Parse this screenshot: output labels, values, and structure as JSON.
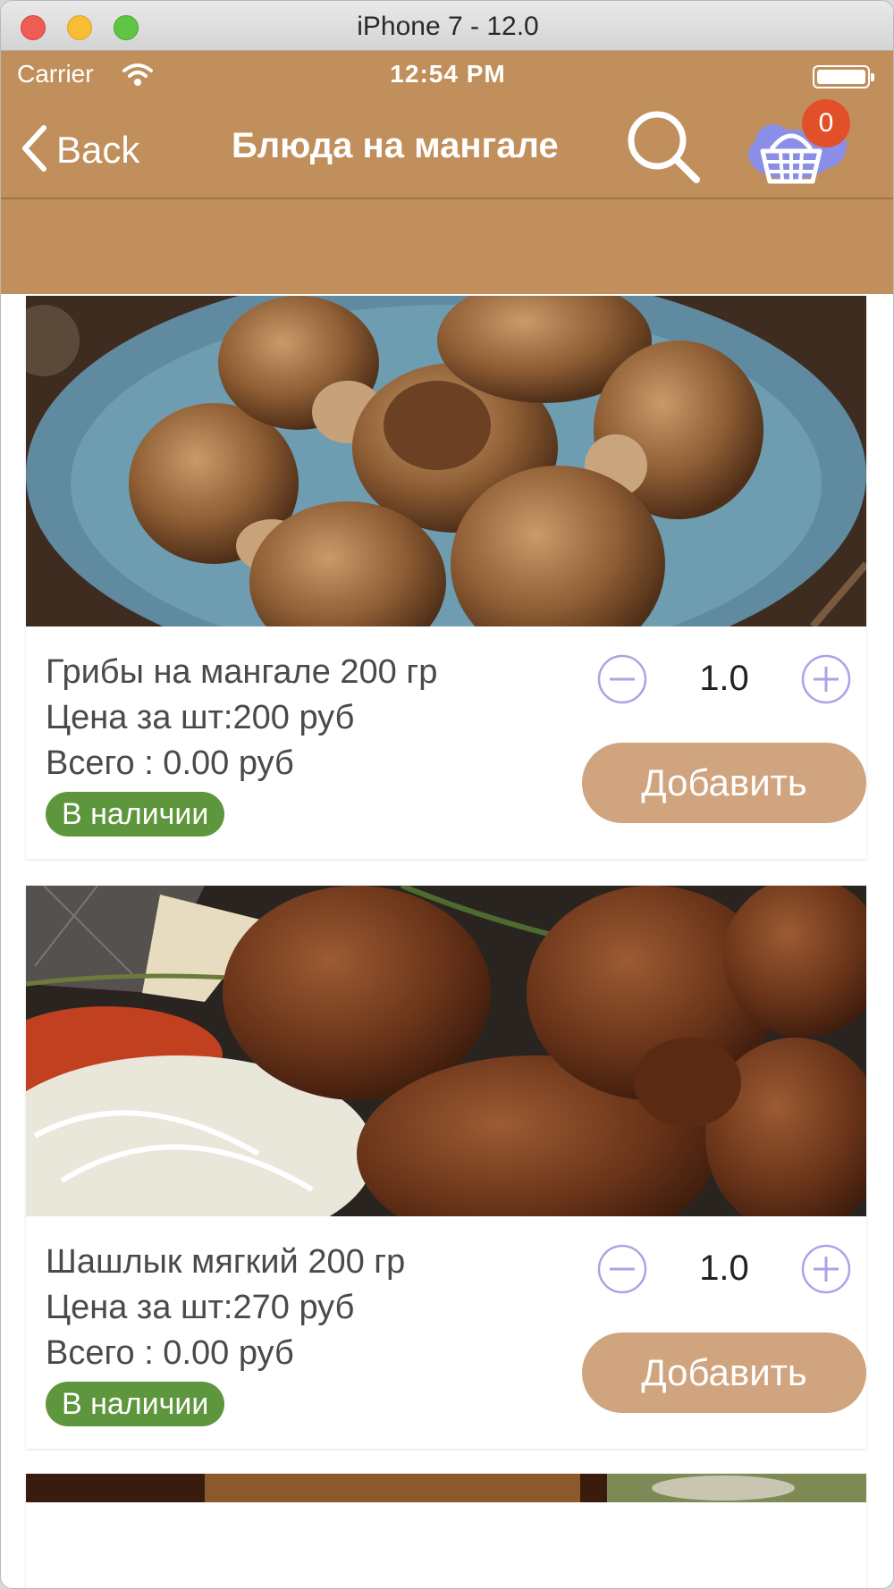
{
  "window": {
    "title": "iPhone 7 - 12.0"
  },
  "statusbar": {
    "carrier": "Carrier",
    "time": "12:54 PM"
  },
  "nav": {
    "back_label": "Back",
    "title": "Блюда на мангале",
    "cart_count": "0"
  },
  "colors": {
    "header": "#c08f5b",
    "add_button": "#cfa47f",
    "in_stock": "#5d963c",
    "badge": "#e2502a",
    "stepper_icon": "#a9a4e6"
  },
  "products": [
    {
      "name": "Грибы на мангале 200 гр",
      "price": "Цена за шт:200 руб",
      "total": "Всего : 0.00 руб",
      "stock": "В наличии",
      "quantity": "1.0",
      "add_label": "Добавить",
      "image": "grilled-mushrooms-photo"
    },
    {
      "name": "Шашлык мягкий 200 гр",
      "price": "Цена за шт:270 руб",
      "total": "Всего : 0.00 руб",
      "stock": "В наличии",
      "quantity": "1.0",
      "add_label": "Добавить",
      "image": "shashlik-photo"
    },
    {
      "image": "grilled-dish-photo"
    }
  ]
}
